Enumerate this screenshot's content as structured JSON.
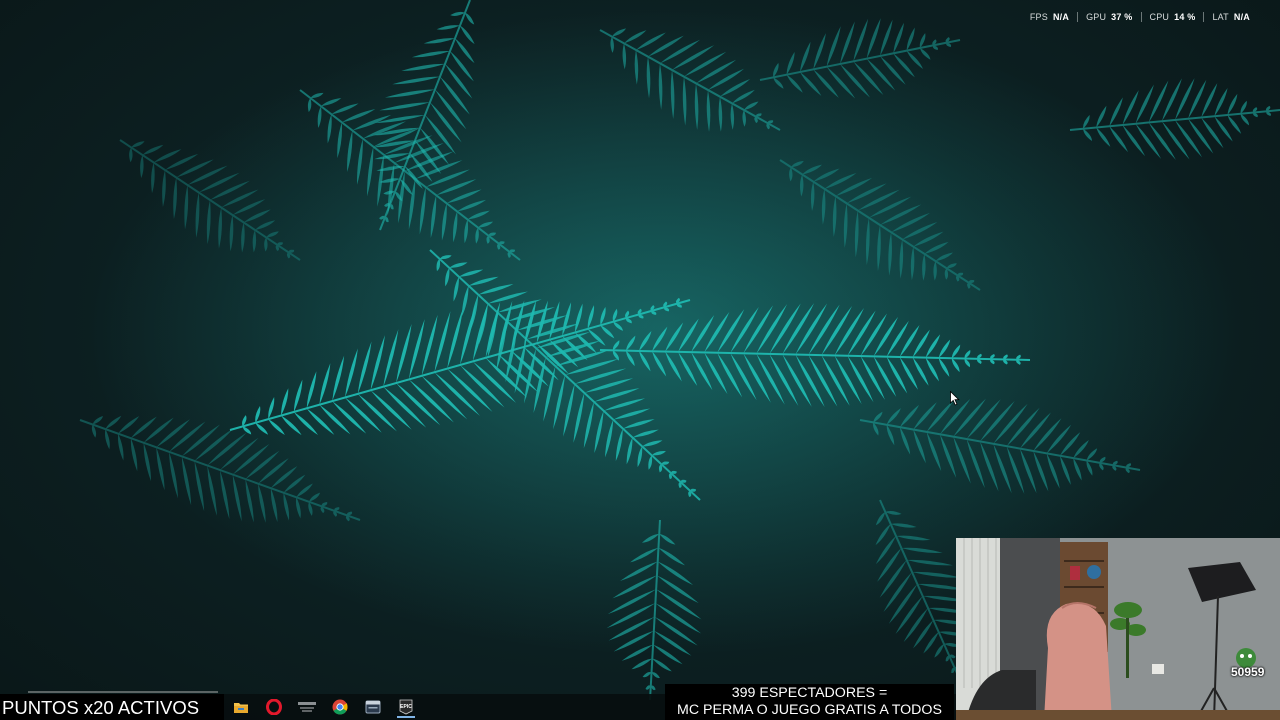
{
  "perf_overlay": {
    "items": [
      {
        "label": "FPS",
        "value": "N/A"
      },
      {
        "label": "GPU",
        "value": "37 %"
      },
      {
        "label": "CPU",
        "value": "14 %"
      },
      {
        "label": "LAT",
        "value": "N/A"
      }
    ]
  },
  "stream_overlay": {
    "points_banner": "PUNTOS x20 ACTIVOS",
    "viewers_line1": "399 ESPECTADORES =",
    "viewers_line2": "MC PERMA O JUEGO GRATIS A TODOS",
    "webcam_counter": "50959"
  },
  "taskbar": {
    "icons": [
      "file-explorer-icon",
      "opera-gx-icon",
      "launcher-icon",
      "chrome-icon",
      "app-window-icon",
      "epic-games-icon"
    ],
    "epic_label": "EPIC"
  },
  "colors": {
    "fern": "#1fb9b0",
    "background": "#0c1a1c"
  }
}
